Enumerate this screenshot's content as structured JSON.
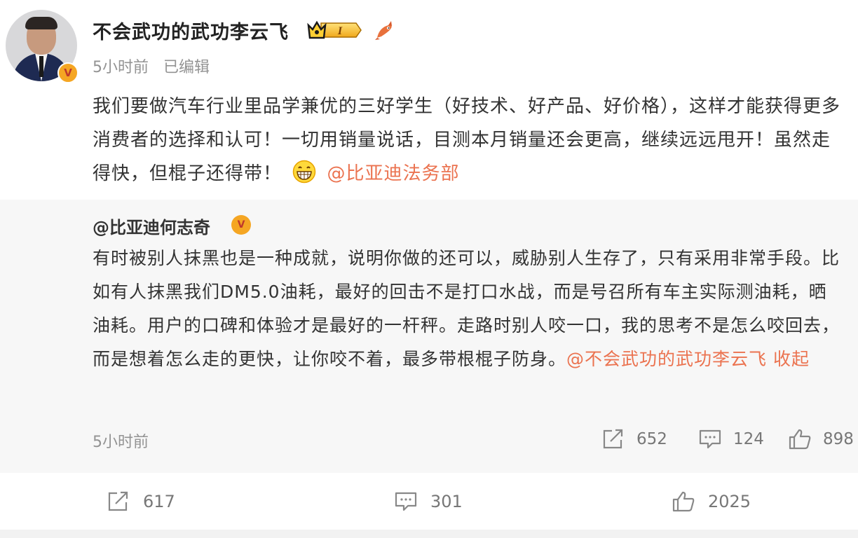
{
  "post": {
    "username": "不会武功的武功李云飞",
    "member_badge": "I",
    "time": "5小时前",
    "edited": "已编辑",
    "content_text": "我们要做汽车行业里品学兼优的三好学生（好技术、好产品、好价格），这样才能获得更多消费者的选择和认可！一切用销量说话，目测本月销量还会更高，继续远远甩开！虽然走得快，但棍子还得带！",
    "content_mention": "@比亚迪法务部"
  },
  "repost": {
    "username": "@比亚迪何志奇",
    "text": "有时被别人抹黑也是一种成就，说明你做的还可以，威胁别人生存了，只有采用非常手段。比如有人抹黑我们DM5.0油耗，最好的回击不是打口水战，而是号召所有车主实际测油耗，晒油耗。用户的口碑和体验才是最好的一杆秤。走路时别人咬一口，我的思考不是怎么咬回去，而是想着怎么走的更快，让你咬不着，最多带根棍子防身。",
    "mention": "@不会武功的武功李云飞",
    "collapse": "收起",
    "time": "5小时前",
    "reposts": "652",
    "comments": "124",
    "likes": "898"
  },
  "actions": {
    "reposts": "617",
    "comments": "301",
    "likes": "2025"
  },
  "colors": {
    "mention": "#eb7350",
    "meta": "#939393",
    "repost_bg": "#f7f7f7",
    "verified": "#f5a623"
  },
  "icons": [
    "verified-v-icon",
    "crown-level-icon",
    "fish-icon",
    "grin-emoji-icon",
    "share-icon",
    "comment-icon",
    "like-icon"
  ]
}
